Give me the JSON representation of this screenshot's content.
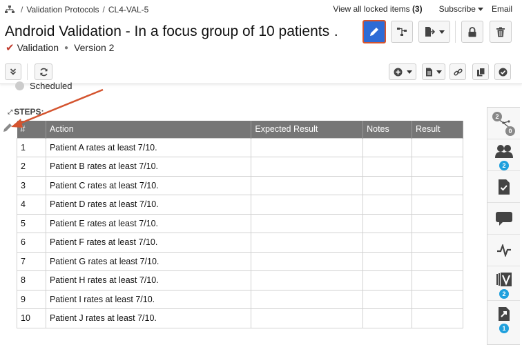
{
  "breadcrumb": {
    "sep1": "/",
    "item1": "Validation Protocols",
    "sep2": "/",
    "item2": "CL4-VAL-5"
  },
  "top_links": {
    "locked_text": "View all locked items",
    "locked_count": "(3)",
    "subscribe": "Subscribe",
    "email": "Email"
  },
  "title": "Android Validation - In a focus group of 10 patients …",
  "subline": {
    "type": "Validation",
    "version": "Version 2"
  },
  "status": {
    "label": "Scheduled"
  },
  "steps": {
    "label": "STEPS:",
    "columns": [
      "#",
      "Action",
      "Expected Result",
      "Notes",
      "Result"
    ],
    "rows": [
      {
        "num": "1",
        "action": "Patient A rates at least 7/10."
      },
      {
        "num": "2",
        "action": "Patient B rates at least 7/10."
      },
      {
        "num": "3",
        "action": "Patient C rates at least 7/10."
      },
      {
        "num": "4",
        "action": "Patient D rates at least 7/10."
      },
      {
        "num": "5",
        "action": "Patient E rates at least 7/10."
      },
      {
        "num": "6",
        "action": "Patient F rates at least 7/10."
      },
      {
        "num": "7",
        "action": "Patient G rates at least 7/10."
      },
      {
        "num": "8",
        "action": "Patient H rates at least 7/10."
      },
      {
        "num": "9",
        "action": "Patient I rates at least 7/10."
      },
      {
        "num": "10",
        "action": "Patient J rates at least 7/10."
      }
    ]
  },
  "side_panel": {
    "relations_badge_top": "2",
    "relations_badge_bottom": "0",
    "followers_badge": "2",
    "versions_badge": "2",
    "links_badge": "1"
  },
  "colors": {
    "edit_button": "#2e6bd6",
    "highlight": "#d4542f",
    "badge": "#1fa0dd",
    "table_header": "#767676"
  }
}
